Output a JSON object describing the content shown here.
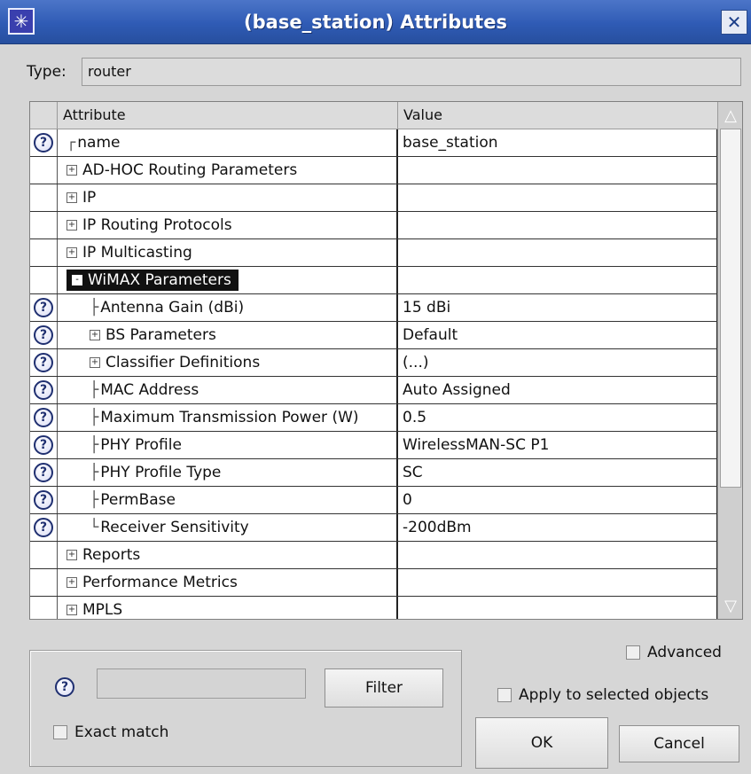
{
  "window": {
    "title": "(base_station) Attributes",
    "close_glyph": "✕"
  },
  "type": {
    "label": "Type:",
    "value": "router"
  },
  "grid": {
    "columns": [
      "Attribute",
      "Value"
    ],
    "rows": [
      {
        "help": true,
        "prefix": "┌",
        "expander": "",
        "indent": 0,
        "label": "name",
        "value": "base_station"
      },
      {
        "help": false,
        "prefix": "",
        "expander": "+",
        "indent": 0,
        "label": "AD-HOC Routing Parameters",
        "value": ""
      },
      {
        "help": false,
        "prefix": "",
        "expander": "+",
        "indent": 0,
        "label": "IP",
        "value": ""
      },
      {
        "help": false,
        "prefix": "",
        "expander": "+",
        "indent": 0,
        "label": "IP Routing Protocols",
        "value": ""
      },
      {
        "help": false,
        "prefix": "",
        "expander": "+",
        "indent": 0,
        "label": "IP Multicasting",
        "value": ""
      },
      {
        "help": false,
        "prefix": "",
        "expander": "-",
        "indent": 0,
        "label": "WiMAX Parameters",
        "value": "",
        "selected": true
      },
      {
        "help": true,
        "prefix": "├",
        "expander": "",
        "indent": 1,
        "label": "Antenna Gain (dBi)",
        "value": "15 dBi"
      },
      {
        "help": true,
        "prefix": "",
        "expander": "+",
        "indent": 1,
        "label": "BS Parameters",
        "value": "Default"
      },
      {
        "help": true,
        "prefix": "",
        "expander": "+",
        "indent": 1,
        "label": "Classifier Definitions",
        "value": "(...)"
      },
      {
        "help": true,
        "prefix": "├",
        "expander": "",
        "indent": 1,
        "label": "MAC Address",
        "value": "Auto Assigned"
      },
      {
        "help": true,
        "prefix": "├",
        "expander": "",
        "indent": 1,
        "label": "Maximum Transmission Power (W)",
        "value": "0.5"
      },
      {
        "help": true,
        "prefix": "├",
        "expander": "",
        "indent": 1,
        "label": "PHY Profile",
        "value": "WirelessMAN-SC P1"
      },
      {
        "help": true,
        "prefix": "├",
        "expander": "",
        "indent": 1,
        "label": "PHY Profile Type",
        "value": "SC"
      },
      {
        "help": true,
        "prefix": "├",
        "expander": "",
        "indent": 1,
        "label": "PermBase",
        "value": "0"
      },
      {
        "help": true,
        "prefix": "└",
        "expander": "",
        "indent": 1,
        "label": "Receiver Sensitivity",
        "value": "-200dBm"
      },
      {
        "help": false,
        "prefix": "",
        "expander": "+",
        "indent": 0,
        "label": "Reports",
        "value": ""
      },
      {
        "help": false,
        "prefix": "",
        "expander": "+",
        "indent": 0,
        "label": "Performance Metrics",
        "value": ""
      },
      {
        "help": false,
        "prefix": "",
        "expander": "+",
        "indent": 0,
        "label": "MPLS",
        "value": ""
      }
    ]
  },
  "filter": {
    "help_glyph": "?",
    "input_value": "",
    "filter_button": "Filter",
    "exact_match_label": "Exact match"
  },
  "options": {
    "advanced_label": "Advanced",
    "apply_label": "Apply to selected objects"
  },
  "buttons": {
    "ok": "OK",
    "cancel": "Cancel"
  },
  "icons": {
    "help": "help-question-icon",
    "expand": "plus-box-icon",
    "collapse": "minus-box-icon",
    "close": "close-icon",
    "app": "app-icon"
  }
}
